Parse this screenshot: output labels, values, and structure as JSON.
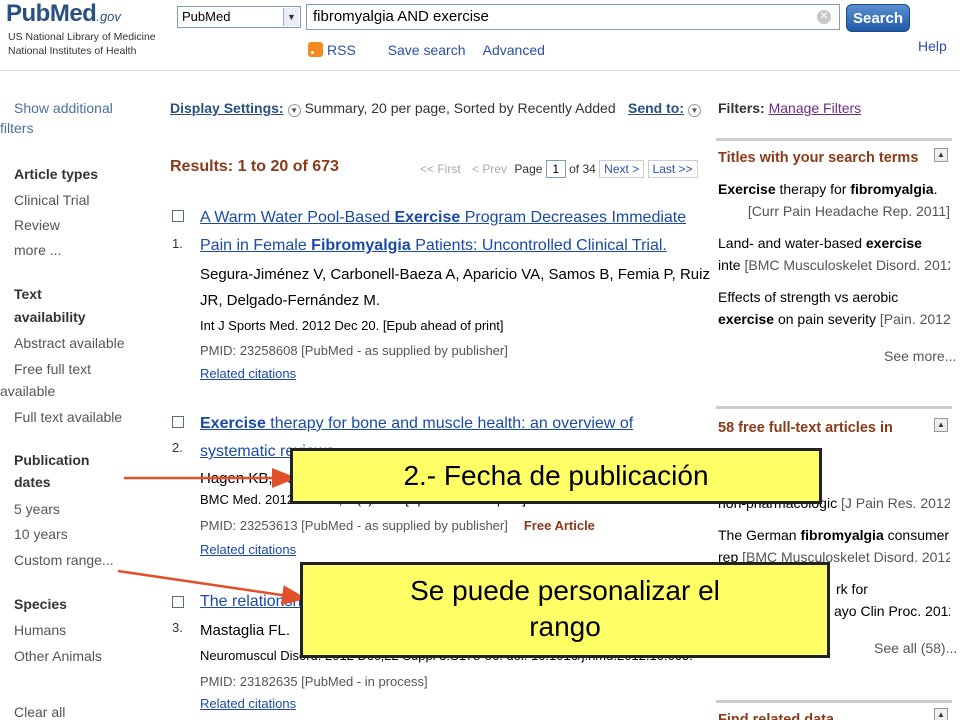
{
  "header": {
    "logo_text": "PubMed",
    "logo_gov": ".gov",
    "org_line1": "US National Library of Medicine",
    "org_line2": "National Institutes of Health",
    "database": "PubMed",
    "search_query": "fibromyalgia AND exercise",
    "search_button": "Search",
    "rss": "RSS",
    "save_search": "Save search",
    "advanced": "Advanced",
    "help": "Help"
  },
  "sidebar": {
    "show_filters_1": "Show additional",
    "show_filters_2": "filters",
    "article_types": "Article types",
    "clinical_trial": "Clinical Trial",
    "review": "Review",
    "more": "more ...",
    "text_avail_1": "Text",
    "text_avail_2": "availability",
    "abstract_available": "Abstract available",
    "free_full_1": "Free full text",
    "free_full_2": "available",
    "full_text_available": "Full text available",
    "pub_dates_1": "Publication",
    "pub_dates_2": "dates",
    "five_years": "5 years",
    "ten_years": "10 years",
    "custom_range": "Custom range...",
    "species": "Species",
    "humans": "Humans",
    "other_animals": "Other Animals",
    "clear_all": "Clear all"
  },
  "display": {
    "label": "Display Settings:",
    "value": "Summary, 20 per page, Sorted by Recently Added",
    "send_to": "Send to:"
  },
  "results": {
    "count": "Results: 1 to 20 of 673",
    "first": "<< First",
    "prev": "< Prev",
    "page_label": "Page",
    "page": "1",
    "of_pages": "of 34",
    "next": "Next >",
    "last": "Last >>"
  },
  "items": [
    {
      "num": "1.",
      "title_a": "A Warm Water Pool-Based ",
      "title_b": "Exercise",
      "title_c": " Program Decreases Immediate Pain in Female ",
      "title_d": "Fibromyalgia",
      "title_e": " Patients: Uncontrolled Clinical Trial.",
      "authors": "Segura-Jiménez V, Carbonell-Baeza A, Aparicio VA, Samos B, Femia P, Ruiz JR, Delgado-Fernández M.",
      "journal": "Int J Sports Med. 2012 Dec 20. [Epub ahead of print]",
      "pmid": "PMID: 23258608 [PubMed - as supplied by publisher]",
      "related": "Related citations"
    },
    {
      "num": "2.",
      "title_a": "Exercise",
      "title_b": " therapy for bone and muscle health: an overview of systematic reviews.",
      "authors": "Hagen KB, Da",
      "journal": "BMC Med. 2012 Dec 19;10(1):167. [Epub ahead of print]",
      "pmid": "PMID: 23253613 [PubMed - as supplied by publisher]",
      "free": "Free Article",
      "related": "Related citations"
    },
    {
      "num": "3.",
      "title_a": "The relationshi",
      "authors": "Mastaglia FL.",
      "journal": "Neuromuscul Disord. 2012 Dec;22 Suppl 3:S178-86. doi: 10.1016/j.nmd.2012.10.005.",
      "pmid": "PMID: 23182635 [PubMed - in process]",
      "related": "Related citations"
    }
  ],
  "right": {
    "filters_label": "Filters:",
    "manage_filters": "Manage Filters",
    "panel1_title": "Titles with your search terms",
    "p1_a_bold1": "Exercise",
    "p1_a_text": " therapy for ",
    "p1_a_bold2": "fibromyalgia",
    "p1_a_src": "[Curr Pain Headache Rep. 2011]",
    "p1_b_text": "Land- and water-based ",
    "p1_b_bold": "exercise",
    "p1_b_line2": "inte",
    "p1_b_src": "[BMC Musculoskelet Disord. 2012]",
    "p1_c_text": "Effects of strength vs aerobic",
    "p1_c_bold": "exercise",
    "p1_c_text2": " on pain severity",
    "p1_c_src": "[Pain. 2012]",
    "see_more": "See more...",
    "panel2_title": "58 free full-text articles in",
    "p2_a": "non-pharmacologic",
    "p2_a_src": "[J Pain Res. 2012]",
    "p2_b_text": "The German ",
    "p2_b_bold": "fibromyalgia",
    "p2_b_text2": " consumer",
    "p2_b_line2": "rep",
    "p2_b_src": "[BMC Musculoskelet Disord. 2012]",
    "p2_c": "rk for",
    "p2_c_src": "ayo Clin Proc. 2012]",
    "see_all": "See all (58)...",
    "panel3_title": "Find related data"
  },
  "annotations": {
    "a1": "2.- Fecha de publicación",
    "a2_line1": "Se puede personalizar  el",
    "a2_line2": "rango"
  },
  "colors": {
    "link": "#1a4aa8",
    "heading_brown": "#8b3a1a",
    "annotation_fill": "#ffff66",
    "arrow": "#e0502a"
  }
}
